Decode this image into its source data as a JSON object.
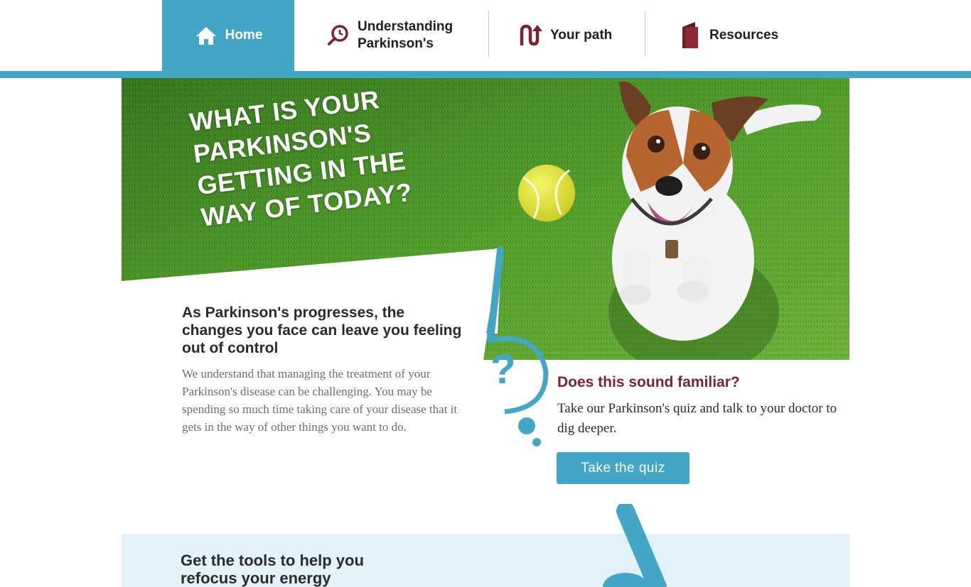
{
  "nav": {
    "items": [
      {
        "label": "Home",
        "icon": "home-icon"
      },
      {
        "label": "Understanding Parkinson's",
        "line1": "Understanding",
        "line2": "Parkinson's",
        "icon": "magnifier-icon"
      },
      {
        "label": "Your path",
        "icon": "path-arrow-icon"
      },
      {
        "label": "Resources",
        "icon": "book-icon"
      }
    ]
  },
  "hero": {
    "title_lines": [
      "WHAT IS YOUR",
      "PARKINSON'S",
      "GETTING IN THE",
      "WAY OF TODAY?"
    ]
  },
  "intro": {
    "heading": "As Parkinson's progresses, the changes you face can leave you feeling out of control",
    "body": "We understand that managing the treatment of your Parkinson's disease can be challenging. You may be spending so much time taking care of your disease that it gets in the way of other things you want to do."
  },
  "quiz": {
    "heading": "Does this sound familiar?",
    "text": "Take our Parkinson's quiz and talk to your doctor to dig deeper.",
    "button_label": "Take the quiz"
  },
  "tools": {
    "heading": "Get the tools to help you refocus your energy"
  },
  "colors": {
    "accent": "#44a6c6",
    "maroon": "#7b2430",
    "grass": "#4f9a2a",
    "tools_bg": "#e3f2f8"
  }
}
